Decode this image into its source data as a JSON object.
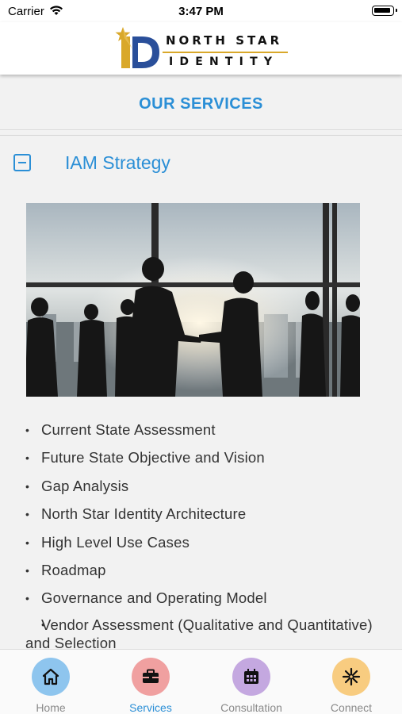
{
  "status_bar": {
    "carrier": "Carrier",
    "time": "3:47 PM"
  },
  "header": {
    "logo_line1": "NORTH STAR",
    "logo_line2": "IDENTITY"
  },
  "page_title": "OUR SERVICES",
  "section": {
    "title": "IAM Strategy",
    "image_alt": "Business people shaking hands in front of office windows",
    "items": [
      "Current State Assessment",
      "Future State Objective and Vision",
      "Gap Analysis",
      "North Star Identity Architecture",
      "High Level Use Cases",
      "Roadmap",
      "Governance and Operating Model",
      "Vendor Assessment (Qualitative and Quantitative) and Selection"
    ]
  },
  "tabs": [
    {
      "label": "Home",
      "icon": "home-icon",
      "color": "#8ec5ee"
    },
    {
      "label": "Services",
      "icon": "briefcase-icon",
      "color": "#f0a0a0",
      "active": true
    },
    {
      "label": "Consultation",
      "icon": "calendar-icon",
      "color": "#c4a8e0"
    },
    {
      "label": "Connect",
      "icon": "snowflake-icon",
      "color": "#f8cc80"
    }
  ],
  "colors": {
    "accent": "#2b8fd6",
    "logo_gold": "#d9a82a",
    "logo_blue": "#2a4f9a"
  }
}
